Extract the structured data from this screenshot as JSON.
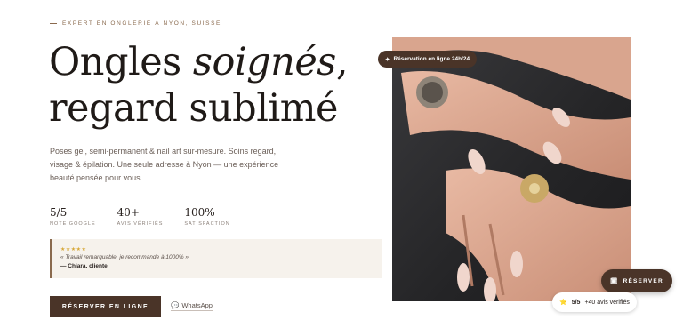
{
  "hero": {
    "eyebrow": "EXPERT EN ONGLERIE À NYON, SUISSE",
    "title_part1": "Ongles ",
    "title_emphasis": "soignés",
    "title_part2": ",",
    "title_line2": "regard sublimé",
    "lead": "Poses gel, semi-permanent & nail art sur-mesure. Soins regard, visage & épilation. Une seule adresse à Nyon — une expérience beauté pensée pour vous."
  },
  "stats": [
    {
      "value": "5/5",
      "caption": "NOTE GOOGLE"
    },
    {
      "value": "40+",
      "caption": "AVIS VÉRIFIÉS"
    },
    {
      "value": "100%",
      "caption": "SATISFACTION"
    }
  ],
  "review": {
    "stars": "★★★★★",
    "quote": "« Travail remarquable, je recommande à 1000% »",
    "author": "— Chiara, cliente"
  },
  "cta": {
    "primary": "RÉSERVER EN LIGNE",
    "whatsapp_icon": "💬",
    "whatsapp": "WhatsApp"
  },
  "photo": {
    "badge_icon": "✦",
    "badge": "Réservation en ligne 24h/24"
  },
  "fab": {
    "icon": "🗓",
    "label": "RÉSERVER"
  },
  "rating_chip": {
    "star": "⭐",
    "score": "5/5",
    "reviews": "+40 avis vérifiés"
  },
  "colors": {
    "brand": "#4a3428",
    "accent": "#8a6a4e",
    "review_bg": "#f6f2ec",
    "star": "#d7a838"
  }
}
